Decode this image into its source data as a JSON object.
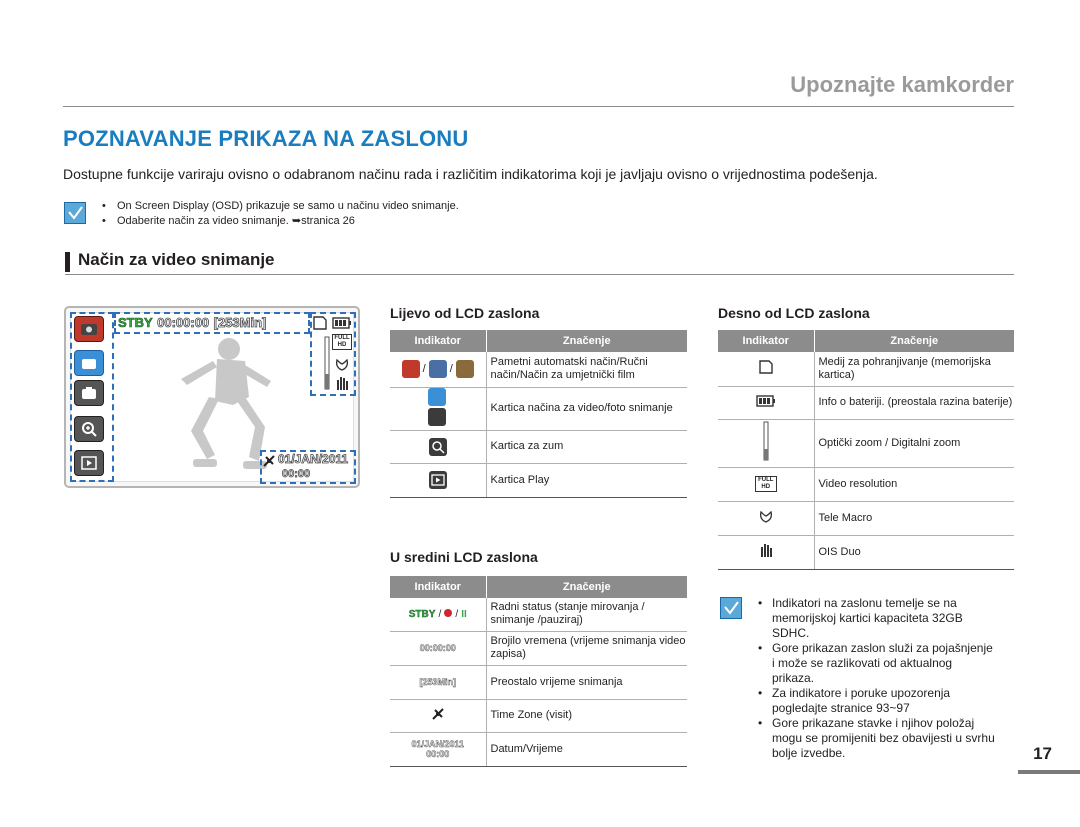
{
  "header": {
    "title": "Upoznajte kamkorder"
  },
  "main_heading": "POZNAVANJE PRIKAZA NA ZASLONU",
  "intro": "Dostupne funkcije variraju ovisno o odabranom načinu rada i različitim indikatorima koji je javljaju ovisno o vrijednostima podešenja.",
  "notes": [
    "On Screen Display (OSD) prikazuje se samo u načinu video snimanje.",
    "Odaberite način za video snimanje. ➥stranica 26"
  ],
  "section_title": "Način za video snimanje",
  "lcd": {
    "status": "STBY",
    "time": "00:00:00",
    "remaining": "[253Min]",
    "date": "01/JAN/2011",
    "clock": "00:00",
    "full_hd_line1": "FULL",
    "full_hd_line2": "HD"
  },
  "left_table": {
    "heading": "Lijevo od LCD zaslona",
    "col_indicator": "Indikator",
    "col_meaning": "Značenje",
    "rows": [
      {
        "meaning": "Pametni automatski način/Ručni način/Način za umjetnički film"
      },
      {
        "meaning": "Kartica načina za video/foto snimanje"
      },
      {
        "meaning": "Kartica za zum"
      },
      {
        "meaning": "Kartica Play"
      }
    ]
  },
  "center_table": {
    "heading": "U sredini LCD zaslona",
    "col_indicator": "Indikator",
    "col_meaning": "Značenje",
    "rows": [
      {
        "indicator": "STBY",
        "meaning": "Radni status (stanje mirovanja / snimanje /pauziraj)"
      },
      {
        "indicator": "00:00:00",
        "meaning": "Brojilo vremena (vrijeme snimanja video zapisa)"
      },
      {
        "indicator": "[253Min]",
        "meaning": "Preostalo vrijeme snimanja"
      },
      {
        "meaning": "Time Zone (visit)"
      },
      {
        "indicator": "01/JAN/2011",
        "indicator2": "00:00",
        "meaning": "Datum/Vrijeme"
      }
    ]
  },
  "right_table": {
    "heading": "Desno od LCD zaslona",
    "col_indicator": "Indikator",
    "col_meaning": "Značenje",
    "rows": [
      {
        "meaning": "Medij za pohranjivanje (memorijska kartica)"
      },
      {
        "meaning": "Info o bateriji. (preostala razina baterije)"
      },
      {
        "meaning": "Optički zoom / Digitalni zoom"
      },
      {
        "indicator": "FULL HD",
        "meaning": "Video resolution"
      },
      {
        "meaning": "Tele Macro"
      },
      {
        "meaning": "OIS Duo"
      }
    ]
  },
  "side_notes": [
    "Indikatori na zaslonu temelje se na memorijskoj kartici kapaciteta 32GB SDHC.",
    "Gore prikazan zaslon služi za pojašnjenje i može se razlikovati od aktualnog prikaza.",
    "Za indikatore i poruke upozorenja pogledajte stranice 93~97",
    "Gore prikazane stavke i njihov položaj mogu se promijeniti bez obavijesti u svrhu bolje izvedbe."
  ],
  "page_number": "17",
  "colors": {
    "accent": "#1a7dc0",
    "dashed_box": "#2e6fb7",
    "header_gray": "#9a9a9a",
    "table_header": "#8c8c8c"
  }
}
